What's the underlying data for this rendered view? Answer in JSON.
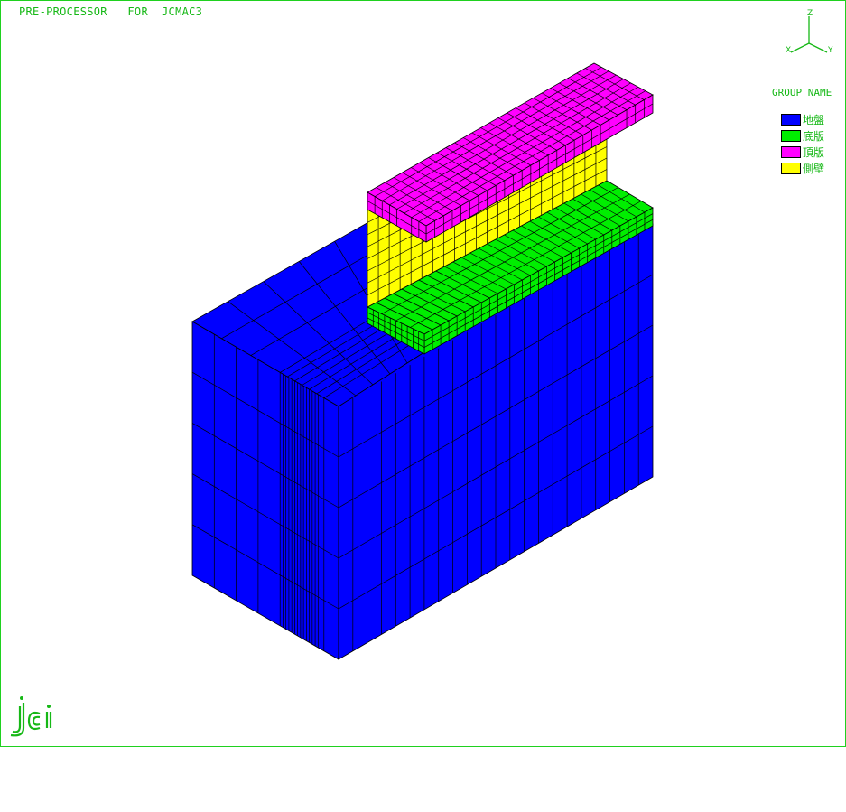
{
  "app": {
    "title": "PRE-PROCESSOR   FOR  JCMAC3"
  },
  "axes": {
    "z": "Z",
    "x": "X",
    "y": "Y"
  },
  "legend": {
    "title": "GROUP NAME",
    "items": [
      {
        "label": "地盤",
        "color": "#0000ff"
      },
      {
        "label": "底版",
        "color": "#00ee00"
      },
      {
        "label": "頂版",
        "color": "#ff00ff"
      },
      {
        "label": "側壁",
        "color": "#ffff00"
      }
    ]
  },
  "mesh_colors": {
    "ground": "#0000ff",
    "base_slab": "#00ee00",
    "top_slab": "#ff00ff",
    "side_wall": "#ffff00",
    "lines": "#000000"
  },
  "logo": {
    "text": "jci",
    "color": "#16b816"
  }
}
